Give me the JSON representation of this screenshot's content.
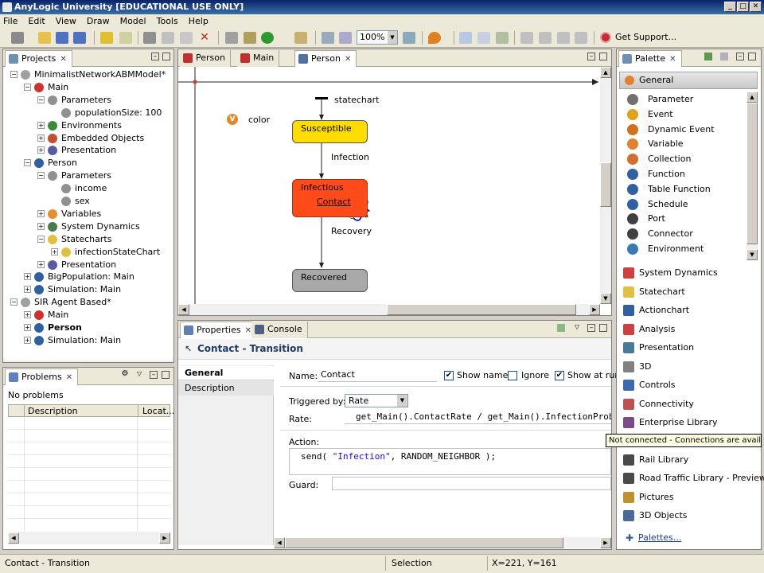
{
  "window": {
    "title": "AnyLogic University [EDUCATIONAL USE ONLY]"
  },
  "menu": [
    "File",
    "Edit",
    "View",
    "Draw",
    "Model",
    "Tools",
    "Help"
  ],
  "toolbar": {
    "zoom": "100%",
    "support_label": "Get Support..."
  },
  "projects": {
    "tab_label": "Projects",
    "tree": [
      {
        "label": "MinimalistNetworkABMModel*",
        "bold": false
      },
      {
        "label": "Main"
      },
      {
        "label": "Parameters"
      },
      {
        "label": "populationSize: 100"
      },
      {
        "label": "Environments"
      },
      {
        "label": "Embedded Objects"
      },
      {
        "label": "Presentation"
      },
      {
        "label": "Person"
      },
      {
        "label": "Parameters"
      },
      {
        "label": "income"
      },
      {
        "label": "sex"
      },
      {
        "label": "Variables"
      },
      {
        "label": "System Dynamics"
      },
      {
        "label": "Statecharts"
      },
      {
        "label": "infectionStateChart"
      },
      {
        "label": "Presentation"
      },
      {
        "label": "BigPopulation: Main"
      },
      {
        "label": "Simulation: Main"
      },
      {
        "label": "SIR Agent Based*"
      },
      {
        "label": "Main"
      },
      {
        "label": "Person"
      },
      {
        "label": "Simulation: Main"
      }
    ]
  },
  "problems": {
    "tab_label": "Problems",
    "status": "No problems",
    "columns": [
      "Description",
      "Locat..."
    ]
  },
  "editor": {
    "tabs": [
      "Person",
      "Main",
      "Person"
    ],
    "canvas": {
      "statechart_label": "statechart",
      "variable_label": "color",
      "states": {
        "susceptible": "Susceptible",
        "infectious": "Infectious",
        "recovered": "Recovered"
      },
      "transitions": {
        "infection": "Infection",
        "contact": "Contact",
        "recovery": "Recovery"
      }
    }
  },
  "properties": {
    "tabs": [
      "Properties",
      "Console"
    ],
    "title": "Contact - Transition",
    "side_tabs": [
      "General",
      "Description"
    ],
    "name_label": "Name:",
    "name_value": "Contact",
    "show_name": "Show name",
    "ignore": "Ignore",
    "show_at_runtime": "Show at run",
    "triggered_by_label": "Triggered by:",
    "triggered_by_value": "Rate",
    "rate_label": "Rate:",
    "rate_value": "get_Main().ContactRate / get_Main().InfectionProb",
    "action_label": "Action:",
    "action_code_prefix": "send( ",
    "action_code_string": "\"Infection\"",
    "action_code_suffix": ", RANDOM_NEIGHBOR );",
    "guard_label": "Guard:"
  },
  "palette": {
    "tab_label": "Palette",
    "section": "General",
    "items": [
      "Parameter",
      "Event",
      "Dynamic Event",
      "Variable",
      "Collection",
      "Function",
      "Table Function",
      "Schedule",
      "Port",
      "Connector",
      "Environment"
    ],
    "categories": [
      "System Dynamics",
      "Statechart",
      "Actionchart",
      "Analysis",
      "Presentation",
      "3D",
      "Controls",
      "Connectivity",
      "Enterprise Library",
      "Rail Library",
      "Road Traffic Library - Preview",
      "Pictures",
      "3D Objects"
    ],
    "palettes_link": "Palettes...",
    "tooltip": "Not connected - Connections are available"
  },
  "status": {
    "left": "Contact - Transition",
    "mode": "Selection",
    "coords": "X=221, Y=161"
  }
}
